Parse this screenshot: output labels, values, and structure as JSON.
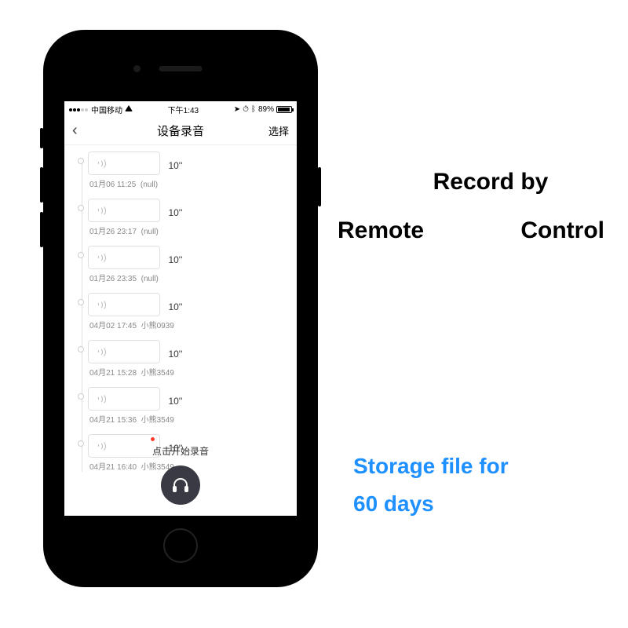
{
  "status": {
    "carrier": "中国移动",
    "time": "下午1:43",
    "location_icon": "➤",
    "alarm_icon": "⏱",
    "bluetooth_icon": "ᛒ",
    "battery_pct": "89%"
  },
  "nav": {
    "back": "‹",
    "title": "设备录音",
    "select": "选择"
  },
  "recordings": [
    {
      "duration": "10''",
      "timestamp": "01月06 11:25",
      "author": "(null)",
      "unread": false
    },
    {
      "duration": "10''",
      "timestamp": "01月26 23:17",
      "author": "(null)",
      "unread": false
    },
    {
      "duration": "10''",
      "timestamp": "01月26 23:35",
      "author": "(null)",
      "unread": false
    },
    {
      "duration": "10''",
      "timestamp": "04月02 17:45",
      "author": "小熊0939",
      "unread": false
    },
    {
      "duration": "10''",
      "timestamp": "04月21 15:28",
      "author": "小熊3549",
      "unread": false
    },
    {
      "duration": "10''",
      "timestamp": "04月21 15:36",
      "author": "小熊3549",
      "unread": false
    },
    {
      "duration": "10''",
      "timestamp": "04月21 16:40",
      "author": "小熊3549",
      "unread": true
    }
  ],
  "footer": {
    "hint": "点击开始录音"
  },
  "promo": {
    "line1": "Record by",
    "line2a": "Remote",
    "line2b": "Control",
    "storage_l1": "Storage file for",
    "storage_l2": "60 days"
  }
}
